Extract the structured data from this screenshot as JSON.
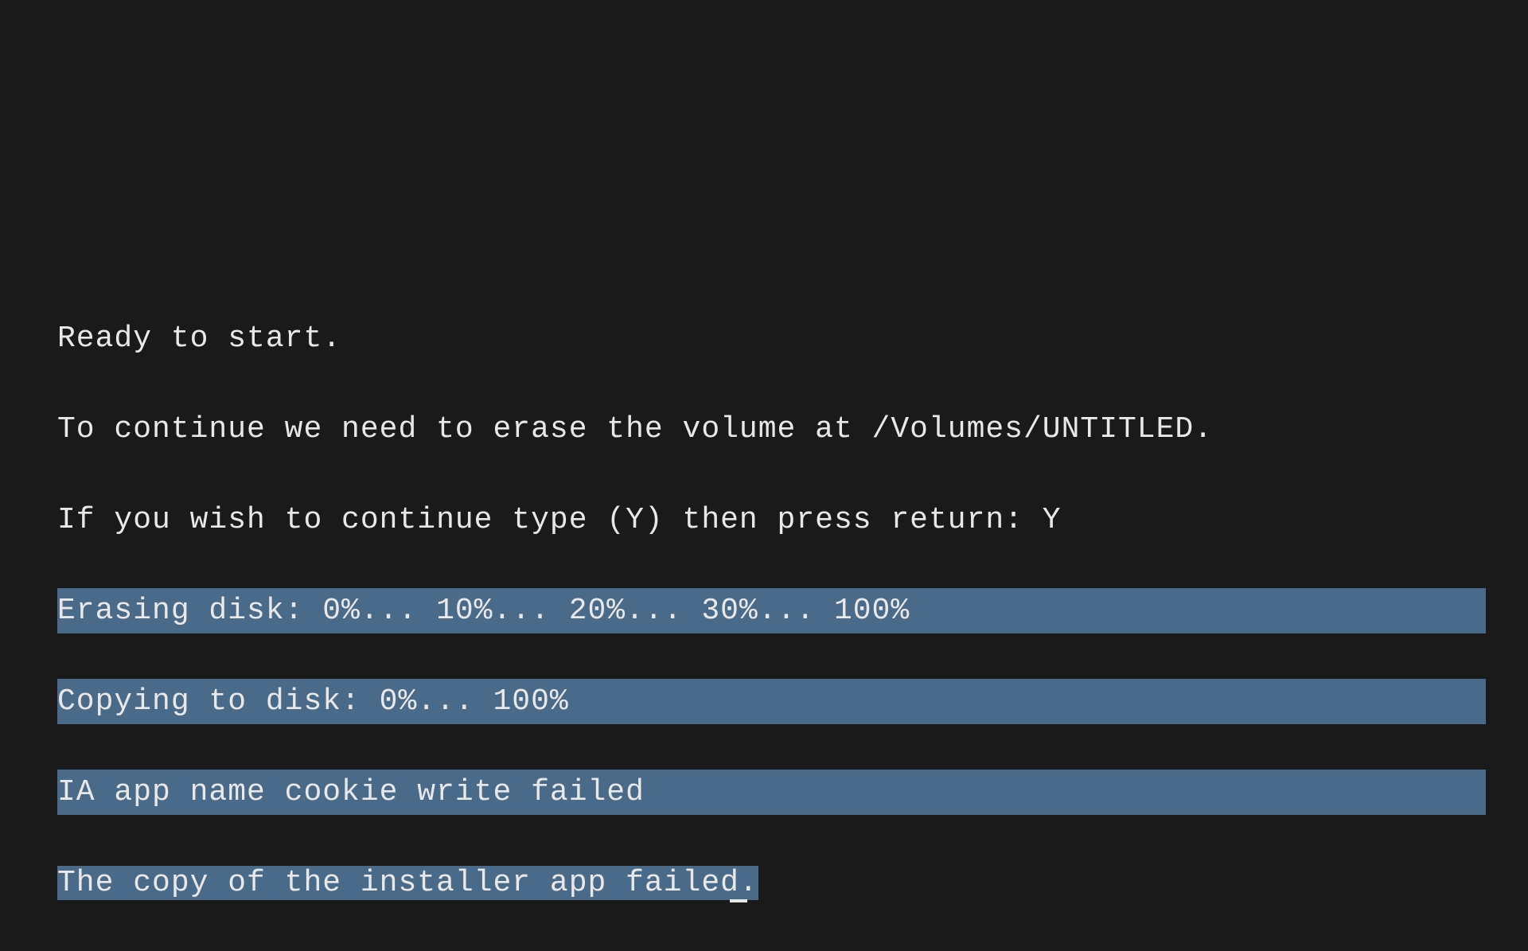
{
  "terminal": {
    "lines": [
      "Ready to start.",
      "To continue we need to erase the volume at /Volumes/UNTITLED.",
      "If you wish to continue type (Y) then press return: Y"
    ],
    "selected_lines": [
      "Erasing disk: 0%... 10%... 20%... 30%... 100%",
      "Copying to disk: 0%... 100%",
      "IA app name cookie write failed"
    ],
    "last_selected": "The copy of the installer app failed."
  }
}
